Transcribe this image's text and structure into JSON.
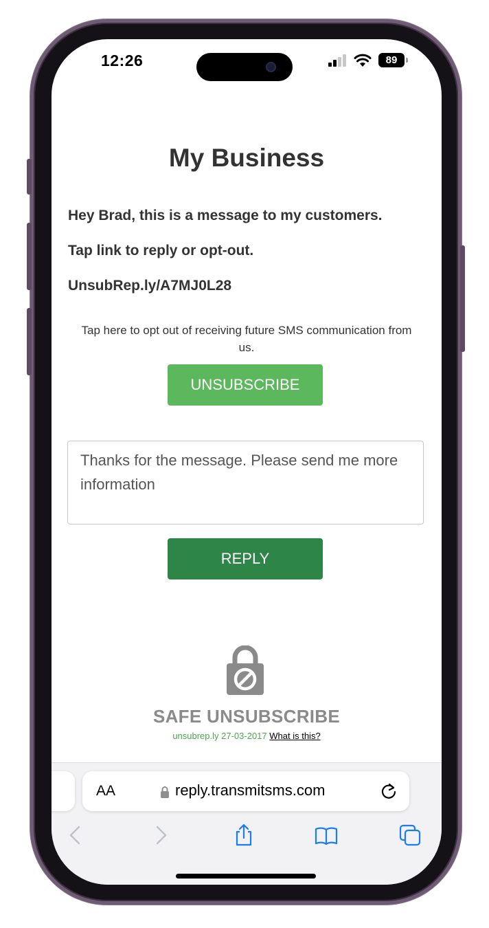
{
  "status": {
    "time": "12:26",
    "battery": "89"
  },
  "page": {
    "title": "My Business",
    "message_lines": [
      "Hey Brad, this is a message to my customers.",
      "Tap link to reply or opt-out.",
      "UnsubRep.ly/A7MJ0L28"
    ],
    "optout_note": "Tap here to opt out of receiving future SMS communication from us.",
    "unsubscribe_label": "UNSUBSCRIBE",
    "reply_text": "Thanks for the message. Please send me more information",
    "reply_label": "REPLY"
  },
  "safe": {
    "title": "SAFE UNSUBSCRIBE",
    "domain_date": "unsubrep.ly 27-03-2017",
    "what_link": "What is this?"
  },
  "browser": {
    "text_size": "AA",
    "url": "reply.transmitsms.com"
  },
  "colors": {
    "unsubscribe": "#5cb85c",
    "reply": "#2e8548",
    "safari_blue": "#1a7cf5",
    "frame": "#6f5b73"
  },
  "icons": [
    "signal-icon",
    "wifi-icon",
    "battery-icon",
    "lock-icon",
    "padlock-icon",
    "reload-icon",
    "back-icon",
    "forward-icon",
    "share-icon",
    "bookmarks-icon",
    "tabs-icon"
  ]
}
